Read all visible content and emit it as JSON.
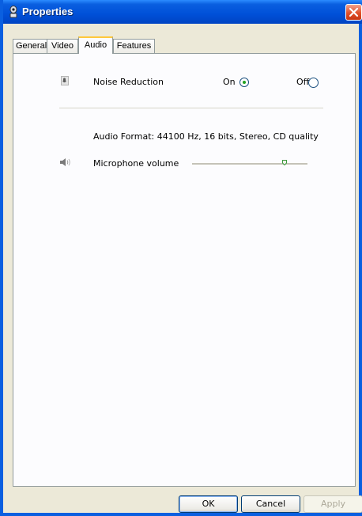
{
  "window": {
    "title": "Properties"
  },
  "tabs": [
    {
      "label": "General",
      "active": false
    },
    {
      "label": "Video",
      "active": false
    },
    {
      "label": "Audio",
      "active": true
    },
    {
      "label": "Features",
      "active": false
    }
  ],
  "audio": {
    "noise_reduction": {
      "label": "Noise Reduction",
      "on_label": "On",
      "off_label": "Off",
      "selected": "On",
      "icon": "microphone-icon"
    },
    "audio_format": "Audio Format: 44100 Hz, 16 bits, Stereo, CD quality",
    "microphone_volume": {
      "label": "Microphone volume",
      "icon": "speaker-icon",
      "level": 0.8
    }
  },
  "buttons": {
    "ok": "OK",
    "cancel": "Cancel",
    "apply": "Apply"
  },
  "colors": {
    "title_bar": "#0a5fe0",
    "close_button": "#e0502b",
    "active_tab_highlight": "#ffc83c",
    "radio_selected": "#21a121"
  }
}
